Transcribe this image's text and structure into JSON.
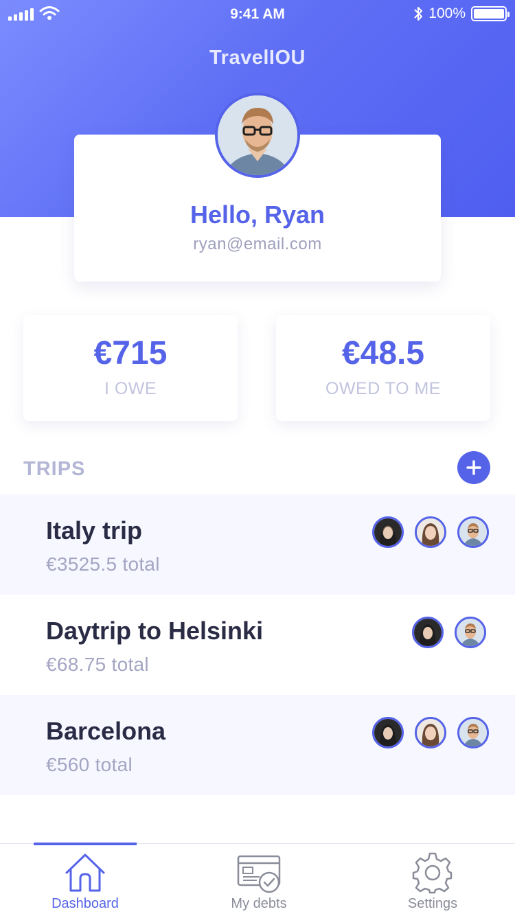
{
  "status_bar": {
    "time": "9:41 AM",
    "battery": "100%"
  },
  "app_title": "TravelIOU",
  "profile": {
    "greeting": "Hello, Ryan",
    "email": "ryan@email.com"
  },
  "stats": {
    "owe": {
      "amount": "€715",
      "label": "I OWE"
    },
    "owed": {
      "amount": "€48.5",
      "label": "OWED TO ME"
    }
  },
  "trips_section": {
    "label": "TRIPS"
  },
  "trips": [
    {
      "name": "Italy trip",
      "total": "€3525.5 total"
    },
    {
      "name": "Daytrip to Helsinki",
      "total": "€68.75 total"
    },
    {
      "name": "Barcelona",
      "total": "€560 total"
    }
  ],
  "tabbar": {
    "items": [
      {
        "label": "Dashboard",
        "icon": "house-icon",
        "active": true
      },
      {
        "label": "My debts",
        "icon": "debts-icon",
        "active": false
      },
      {
        "label": "Settings",
        "icon": "gear-icon",
        "active": false
      }
    ]
  },
  "colors": {
    "accent": "#5563e8",
    "header_gradient_start": "#7b8cff",
    "header_gradient_end": "#4f5ef0",
    "muted_text": "#a3a5c3",
    "row_alt_bg": "#f7f8ff"
  }
}
